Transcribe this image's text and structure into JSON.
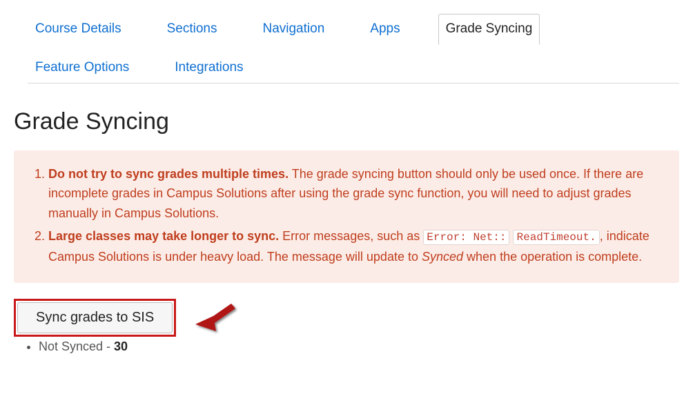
{
  "tabs": [
    {
      "label": "Course Details",
      "active": false
    },
    {
      "label": "Sections",
      "active": false
    },
    {
      "label": "Navigation",
      "active": false
    },
    {
      "label": "Apps",
      "active": false
    },
    {
      "label": "Grade Syncing",
      "active": true
    },
    {
      "label": "Feature Options",
      "active": false
    },
    {
      "label": "Integrations",
      "active": false
    }
  ],
  "title": "Grade Syncing",
  "warning": {
    "item1_strong": "Do not try to sync grades multiple times.",
    "item1_rest": " The grade syncing button should only be used once. If there are incomplete grades in Campus Solutions after using the grade sync function, you will need to adjust grades manually in Campus Solutions.",
    "item2_strong": "Large classes may take longer to sync.",
    "item2_part_a": " Error messages, such as ",
    "item2_code1": "Error: Net::",
    "item2_code2": "ReadTimeout.",
    "item2_part_b": ", indicate Campus Solutions is under heavy load. The message will update to ",
    "item2_em": "Synced",
    "item2_part_c": " when the operation is complete."
  },
  "button": {
    "label": "Sync grades to SIS"
  },
  "status": {
    "prefix": "Not Synced - ",
    "count": "30"
  }
}
